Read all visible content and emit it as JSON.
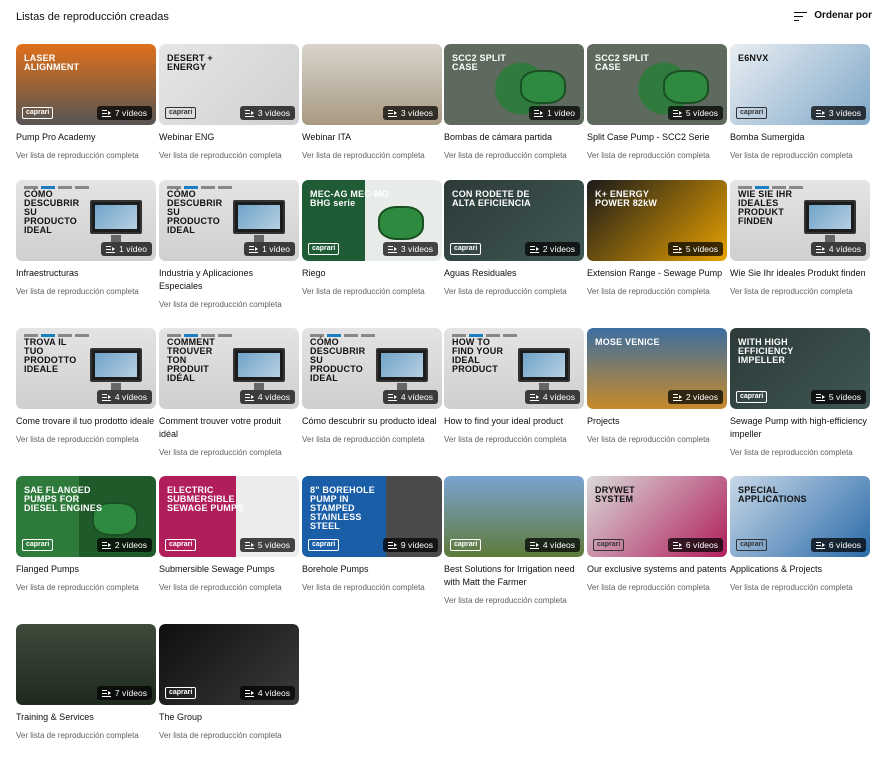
{
  "header": {
    "title": "Listas de reproducción creadas",
    "sort_label": "Ordenar por"
  },
  "link_label": "Ver lista de reproducción completa",
  "colors": {
    "primary_text": "#0f0f0f",
    "secondary_text": "#606060",
    "badge_bg": "#000000"
  },
  "playlists": [
    {
      "title": "Pump Pro Academy",
      "count": "7 vídeos",
      "overlay": "LASER ALIGNMENT",
      "brand": "caprari",
      "bg": "#e0701a",
      "bg2": "#555555",
      "variant": "photo"
    },
    {
      "title": "Webinar ENG",
      "count": "3 vídeos",
      "overlay": "DESERT + ENERGY",
      "brand": "caprari",
      "bg": "#e6e6e6",
      "bg2": "#d0d0d0",
      "variant": "light"
    },
    {
      "title": "Webinar ITA",
      "count": "3 vídeos",
      "overlay": "",
      "brand": "",
      "bg": "#d8d4cc",
      "bg2": "#a89a82",
      "variant": "photo"
    },
    {
      "title": "Bombas de cámara partida",
      "count": "1 vídeo",
      "overlay": "SCC2 SPLIT CASE",
      "brand": "",
      "bg": "#5e6a5d",
      "bg2": "#2f7a3c",
      "variant": "pump"
    },
    {
      "title": "Split Case Pump - SCC2 Serie",
      "count": "5 vídeos",
      "overlay": "SCC2 SPLIT CASE",
      "brand": "",
      "bg": "#5e6a5d",
      "bg2": "#2f7a3c",
      "variant": "pump"
    },
    {
      "title": "Bomba Sumergida",
      "count": "3 vídeos",
      "overlay": "E6NVX",
      "brand": "caprari",
      "bg": "#e9eef2",
      "bg2": "#7fa7c8",
      "variant": "light"
    },
    {
      "title": "Infraestructuras",
      "count": "1 vídeo",
      "overlay": "CÓMO DESCUBRIR SU PRODUCTO IDEAL",
      "brand": "",
      "bg": "#e4e4e4",
      "bg2": "#cfcfcf",
      "variant": "monitor"
    },
    {
      "title": "Industria y Aplicaciones Especiales",
      "count": "1 vídeo",
      "overlay": "CÓMO DESCUBRIR SU PRODUCTO IDEAL",
      "brand": "",
      "bg": "#e4e4e4",
      "bg2": "#cfcfcf",
      "variant": "monitor"
    },
    {
      "title": "Riego",
      "count": "3 vídeos",
      "overlay": "MEC-AG MEC-MG BHG serie",
      "brand": "caprari",
      "bg": "#1f5c36",
      "bg2": "#e8ece8",
      "variant": "green"
    },
    {
      "title": "Aguas Residuales",
      "count": "2 vídeos",
      "overlay": "CON RODETE DE ALTA EFICIENCIA",
      "brand": "caprari",
      "bg": "#2c3a38",
      "bg2": "#3f5753",
      "variant": "dark"
    },
    {
      "title": "Extension Range - Sewage Pump",
      "count": "5 vídeos",
      "overlay": "K+ ENERGY POWER 82kW",
      "brand": "",
      "bg": "#1a1a1a",
      "bg2": "#e8a100",
      "variant": "dark"
    },
    {
      "title": "Wie Sie Ihr ideales Produkt finden",
      "count": "4 vídeos",
      "overlay": "WIE SIE IHR IDEALES PRODUKT FINDEN",
      "brand": "",
      "bg": "#e4e4e4",
      "bg2": "#cfcfcf",
      "variant": "monitor"
    },
    {
      "title": "Come trovare il tuo prodotto ideale",
      "count": "4 vídeos",
      "overlay": "TROVA IL TUO PRODOTTO IDEALE",
      "brand": "",
      "bg": "#e4e4e4",
      "bg2": "#cfcfcf",
      "variant": "monitor"
    },
    {
      "title": "Comment trouver votre produit idéal",
      "count": "4 vídeos",
      "overlay": "COMMENT TROUVER TON PRODUIT IDÉAL",
      "brand": "",
      "bg": "#e4e4e4",
      "bg2": "#cfcfcf",
      "variant": "monitor"
    },
    {
      "title": "Cómo descubrir su producto ideal",
      "count": "4 vídeos",
      "overlay": "CÓMO DESCUBRIR SU PRODUCTO IDEAL",
      "brand": "",
      "bg": "#e4e4e4",
      "bg2": "#cfcfcf",
      "variant": "monitor"
    },
    {
      "title": "How to find your ideal product",
      "count": "4 vídeos",
      "overlay": "HOW TO FIND YOUR IDEAL PRODUCT",
      "brand": "",
      "bg": "#e4e4e4",
      "bg2": "#cfcfcf",
      "variant": "monitor"
    },
    {
      "title": "Projects",
      "count": "2 vídeos",
      "overlay": "MOSE VENICE",
      "brand": "",
      "bg": "#3c6ea0",
      "bg2": "#c88a2a",
      "variant": "photo"
    },
    {
      "title": "Sewage Pump with high-efficiency impeller",
      "count": "5 vídeos",
      "overlay": "WITH HIGH EFFICIENCY IMPELLER",
      "brand": "caprari",
      "bg": "#2c3a38",
      "bg2": "#3f5753",
      "variant": "dark"
    },
    {
      "title": "Flanged Pumps",
      "count": "2 vídeos",
      "overlay": "SAE FLANGED PUMPS FOR DIESEL ENGINES",
      "brand": "caprari",
      "bg": "#2d7a3a",
      "bg2": "#1e5a2a",
      "variant": "green"
    },
    {
      "title": "Submersible Sewage Pumps",
      "count": "5 vídeos",
      "overlay": "ELECTRIC SUBMERSIBLE SEWAGE PUMPS",
      "brand": "caprari",
      "bg": "#b01e5c",
      "bg2": "#ececec",
      "variant": "magenta"
    },
    {
      "title": "Borehole Pumps",
      "count": "9 vídeos",
      "overlay": "8\" BOREHOLE PUMP IN STAMPED STAINLESS STEEL",
      "brand": "caprari",
      "bg": "#1a5ea8",
      "bg2": "#4a4a4a",
      "variant": "blue"
    },
    {
      "title": "Best Solutions for Irrigation need with Matt the Farmer",
      "count": "4 vídeos",
      "overlay": "",
      "brand": "caprari",
      "bg": "#7aa3d0",
      "bg2": "#5e7a3a",
      "variant": "photo"
    },
    {
      "title": "Our exclusive systems and patents",
      "count": "6 vídeos",
      "overlay": "DRYWET SYSTEM",
      "brand": "caprari",
      "bg": "#d9d9d9",
      "bg2": "#b01e5c",
      "variant": "light"
    },
    {
      "title": "Applications & Projects",
      "count": "6 vídeos",
      "overlay": "SPECIAL APPLICATIONS",
      "brand": "caprari",
      "bg": "#c8d8e8",
      "bg2": "#2a6aa8",
      "variant": "light"
    },
    {
      "title": "Training & Services",
      "count": "7 vídeos",
      "overlay": "",
      "brand": "",
      "bg": "#3e4a3a",
      "bg2": "#1e2a1e",
      "variant": "photo"
    },
    {
      "title": "The Group",
      "count": "4 vídeos",
      "overlay": "",
      "brand": "caprari",
      "bg": "#0f0f0f",
      "bg2": "#3a3a3a",
      "variant": "dark"
    }
  ]
}
